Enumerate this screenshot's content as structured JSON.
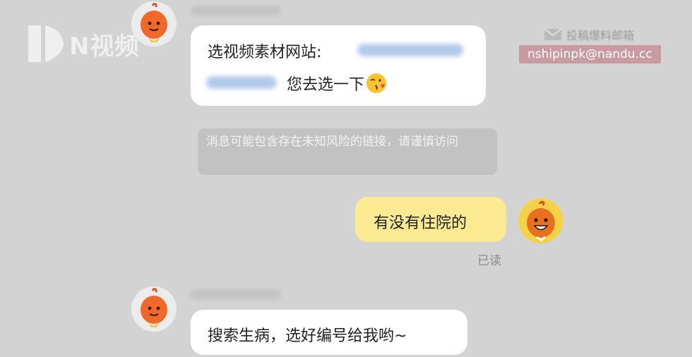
{
  "watermark": {
    "brand_text": "N视频"
  },
  "mailbox": {
    "label": "投稿爆料邮箱",
    "email": "nshipinpk@nandu.cc"
  },
  "messages": [
    {
      "side": "left",
      "line1": "选视频素材网站:",
      "line2": "您去选一下",
      "emoji": "kissing-wink-emoji"
    },
    {
      "side": "system",
      "text": "消息可能包含存在未知风险的链接，请谨慎访问"
    },
    {
      "side": "right",
      "text": "有没有住院的",
      "status": "已读"
    },
    {
      "side": "left",
      "text": "搜索生病，选好编号给我哟~"
    }
  ],
  "colors": {
    "background": "#d3d3d3",
    "bubble_in": "#ffffff",
    "bubble_out": "#fbea91",
    "email_tag": "#c99aa2",
    "notice_bg": "#c2c2c2"
  }
}
